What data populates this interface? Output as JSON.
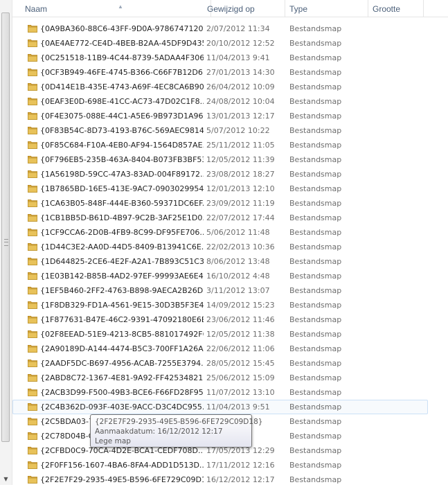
{
  "header": {
    "name": "Naam",
    "modified": "Gewijzigd op",
    "type": "Type",
    "size": "Grootte"
  },
  "rows": [
    {
      "name": "{0A9BA360-88C6-43FF-9D0A-9786747120...",
      "date": "2/07/2012 11:34",
      "type": "Bestandsmap"
    },
    {
      "name": "{0AE4AE772-CE4D-4BEB-B2AA-45DF9D435...",
      "date": "20/10/2012 12:52",
      "type": "Bestandsmap"
    },
    {
      "name": "{0C251518-11B9-4C44-8739-5ADAA4F306...",
      "date": "11/04/2013 9:41",
      "type": "Bestandsmap"
    },
    {
      "name": "{0CF3B949-46FE-4745-B366-C66F7B12D6...",
      "date": "27/01/2013 14:30",
      "type": "Bestandsmap"
    },
    {
      "name": "{0D414E1B-435E-4743-A69F-4EC8CA6B90...",
      "date": "26/04/2012 10:09",
      "type": "Bestandsmap"
    },
    {
      "name": "{0EAF3E0D-698E-41CC-AC73-47D02C1F8...",
      "date": "24/08/2012 10:04",
      "type": "Bestandsmap"
    },
    {
      "name": "{0F4E3075-088E-44C1-A5E6-9B973D1A96...",
      "date": "13/01/2013 12:17",
      "type": "Bestandsmap"
    },
    {
      "name": "{0F83B54C-8D73-4193-B76C-569AEC9814...",
      "date": "5/07/2012 10:22",
      "type": "Bestandsmap"
    },
    {
      "name": "{0F85C684-F10A-4EB0-AF94-1564D857AE...",
      "date": "25/11/2012 11:05",
      "type": "Bestandsmap"
    },
    {
      "name": "{0F796EB5-235B-463A-8404-B073FB3BF53...",
      "date": "12/05/2012 11:39",
      "type": "Bestandsmap"
    },
    {
      "name": "{1A56198D-59CC-47A3-83AD-004F89172...",
      "date": "23/08/2012 18:27",
      "type": "Bestandsmap"
    },
    {
      "name": "{1B7865BD-16E5-413E-9AC7-0903029954...",
      "date": "12/01/2013 12:10",
      "type": "Bestandsmap"
    },
    {
      "name": "{1CA63B05-848F-444E-B360-59371DC6EF...",
      "date": "23/09/2012 11:19",
      "type": "Bestandsmap"
    },
    {
      "name": "{1CB1BB5D-B61D-4B97-9C2B-3AF25E1D0...",
      "date": "22/07/2012 17:44",
      "type": "Bestandsmap"
    },
    {
      "name": "{1CF9CCA6-2D0B-4FB9-8C99-DF95FE706...",
      "date": "5/06/2012 11:48",
      "type": "Bestandsmap"
    },
    {
      "name": "{1D44C3E2-AA0D-44D5-8409-B13941C6E...",
      "date": "22/02/2013 10:36",
      "type": "Bestandsmap"
    },
    {
      "name": "{1D644825-2CE6-4E2F-A2A1-7B893C51C3...",
      "date": "8/06/2012 13:48",
      "type": "Bestandsmap"
    },
    {
      "name": "{1E03B142-B85B-4AD2-97EF-99993AE6E4...",
      "date": "16/10/2012 4:48",
      "type": "Bestandsmap"
    },
    {
      "name": "{1EF5B460-2FF2-4763-B898-9AECA2B26D...",
      "date": "3/11/2012 13:07",
      "type": "Bestandsmap"
    },
    {
      "name": "{1F8DB329-FD1A-4561-9E15-30D3B5F3E4...",
      "date": "14/09/2012 15:23",
      "type": "Bestandsmap"
    },
    {
      "name": "{1F877631-B47E-46C2-9391-47092180E6EF}",
      "date": "23/06/2012 11:46",
      "type": "Bestandsmap"
    },
    {
      "name": "{02F8EEAD-51E9-4213-8CB5-881017492F6...",
      "date": "12/05/2012 11:38",
      "type": "Bestandsmap"
    },
    {
      "name": "{2A90189D-A144-4474-B5C3-700FF1A26A...",
      "date": "22/06/2012 11:06",
      "type": "Bestandsmap"
    },
    {
      "name": "{2AADF5DC-B697-4956-ACAB-7255E3794...",
      "date": "28/05/2012 15:45",
      "type": "Bestandsmap"
    },
    {
      "name": "{2ABD8C72-1367-4E81-9A92-FF42534821...",
      "date": "25/06/2012 15:09",
      "type": "Bestandsmap"
    },
    {
      "name": "{2ACB3D99-F500-49B3-BCE6-F66FD28F95...",
      "date": "11/07/2012 13:10",
      "type": "Bestandsmap"
    },
    {
      "name": "{2C4B362D-093F-403E-9ACC-D3C4DC955...",
      "date": "11/04/2013 9:51",
      "type": "Bestandsmap",
      "selected": true
    },
    {
      "name": "{2C5BDA03-7",
      "date": "35",
      "type": "Bestandsmap"
    },
    {
      "name": "{2C78D04B-C",
      "date": "01",
      "type": "Bestandsmap"
    },
    {
      "name": "{2CFBD0C9-70CA-4D2E-BCA1-CEDF708D...",
      "date": "17/05/2013 12:29",
      "type": "Bestandsmap"
    },
    {
      "name": "{2F0FF156-1607-4BA6-8FA4-ADD1D513D...",
      "date": "17/11/2012 12:16",
      "type": "Bestandsmap"
    },
    {
      "name": "{2F2E7F29-2935-49E5-B596-6FE729C09D18}",
      "date": "16/12/2012 12:17",
      "type": "Bestandsmap"
    }
  ],
  "tooltip": {
    "line1": "{2F2E7F29-2935-49E5-B596-6FE729C09D18}",
    "line2": "Aanmaakdatum: 16/12/2012 12:17",
    "line3": "Lege map"
  },
  "colors": {
    "folder": "#e8c25a",
    "selection_border": "#cbe0f6",
    "header_text": "#4c607a"
  }
}
